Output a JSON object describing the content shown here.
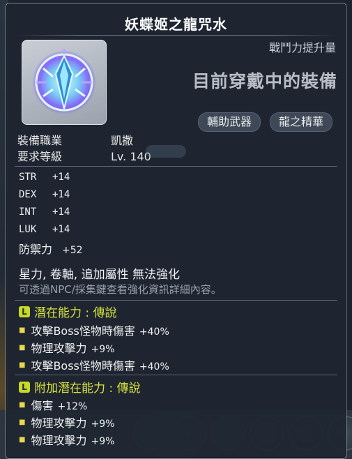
{
  "item": {
    "name": "妖蝶姬之龍咒水",
    "power_label": "戰鬥力提升量",
    "equipped_label": "目前穿戴中的裝備",
    "tags": [
      "輔助武器",
      "龍之精華"
    ]
  },
  "requirements": [
    {
      "key": "裝備職業",
      "value": "凱撒"
    },
    {
      "key": "要求等級",
      "value": "Lv. 140"
    }
  ],
  "stats": [
    {
      "name": "STR",
      "value": "+14"
    },
    {
      "name": "DEX",
      "value": "+14"
    },
    {
      "name": "INT",
      "value": "+14"
    },
    {
      "name": "LUK",
      "value": "+14"
    }
  ],
  "defense": {
    "name": "防禦力",
    "value": "+52"
  },
  "notes": {
    "restriction": "星力, 卷軸, 追加屬性 無法強化",
    "hint": "可透過NPC/採集鍵查看強化資訊詳細內容。"
  },
  "potential": {
    "badge": "L",
    "title": "潛在能力 : 傳說",
    "lines": [
      {
        "name": "攻擊Boss怪物時傷害",
        "value": "+40%"
      },
      {
        "name": "物理攻擊力",
        "value": "+9%"
      },
      {
        "name": "攻擊Boss怪物時傷害",
        "value": "+40%"
      }
    ]
  },
  "additional_potential": {
    "badge": "L",
    "title": "附加潛在能力 : 傳說",
    "lines": [
      {
        "name": "傷害",
        "value": "+12%"
      },
      {
        "name": "物理攻擊力",
        "value": "+9%"
      },
      {
        "name": "物理攻擊力",
        "value": "+9%"
      }
    ]
  },
  "colors": {
    "legendary": "#d8e33a",
    "panel_bg": "#1e2632",
    "text": "#f0f0f0",
    "hint": "#9aa3ad"
  }
}
